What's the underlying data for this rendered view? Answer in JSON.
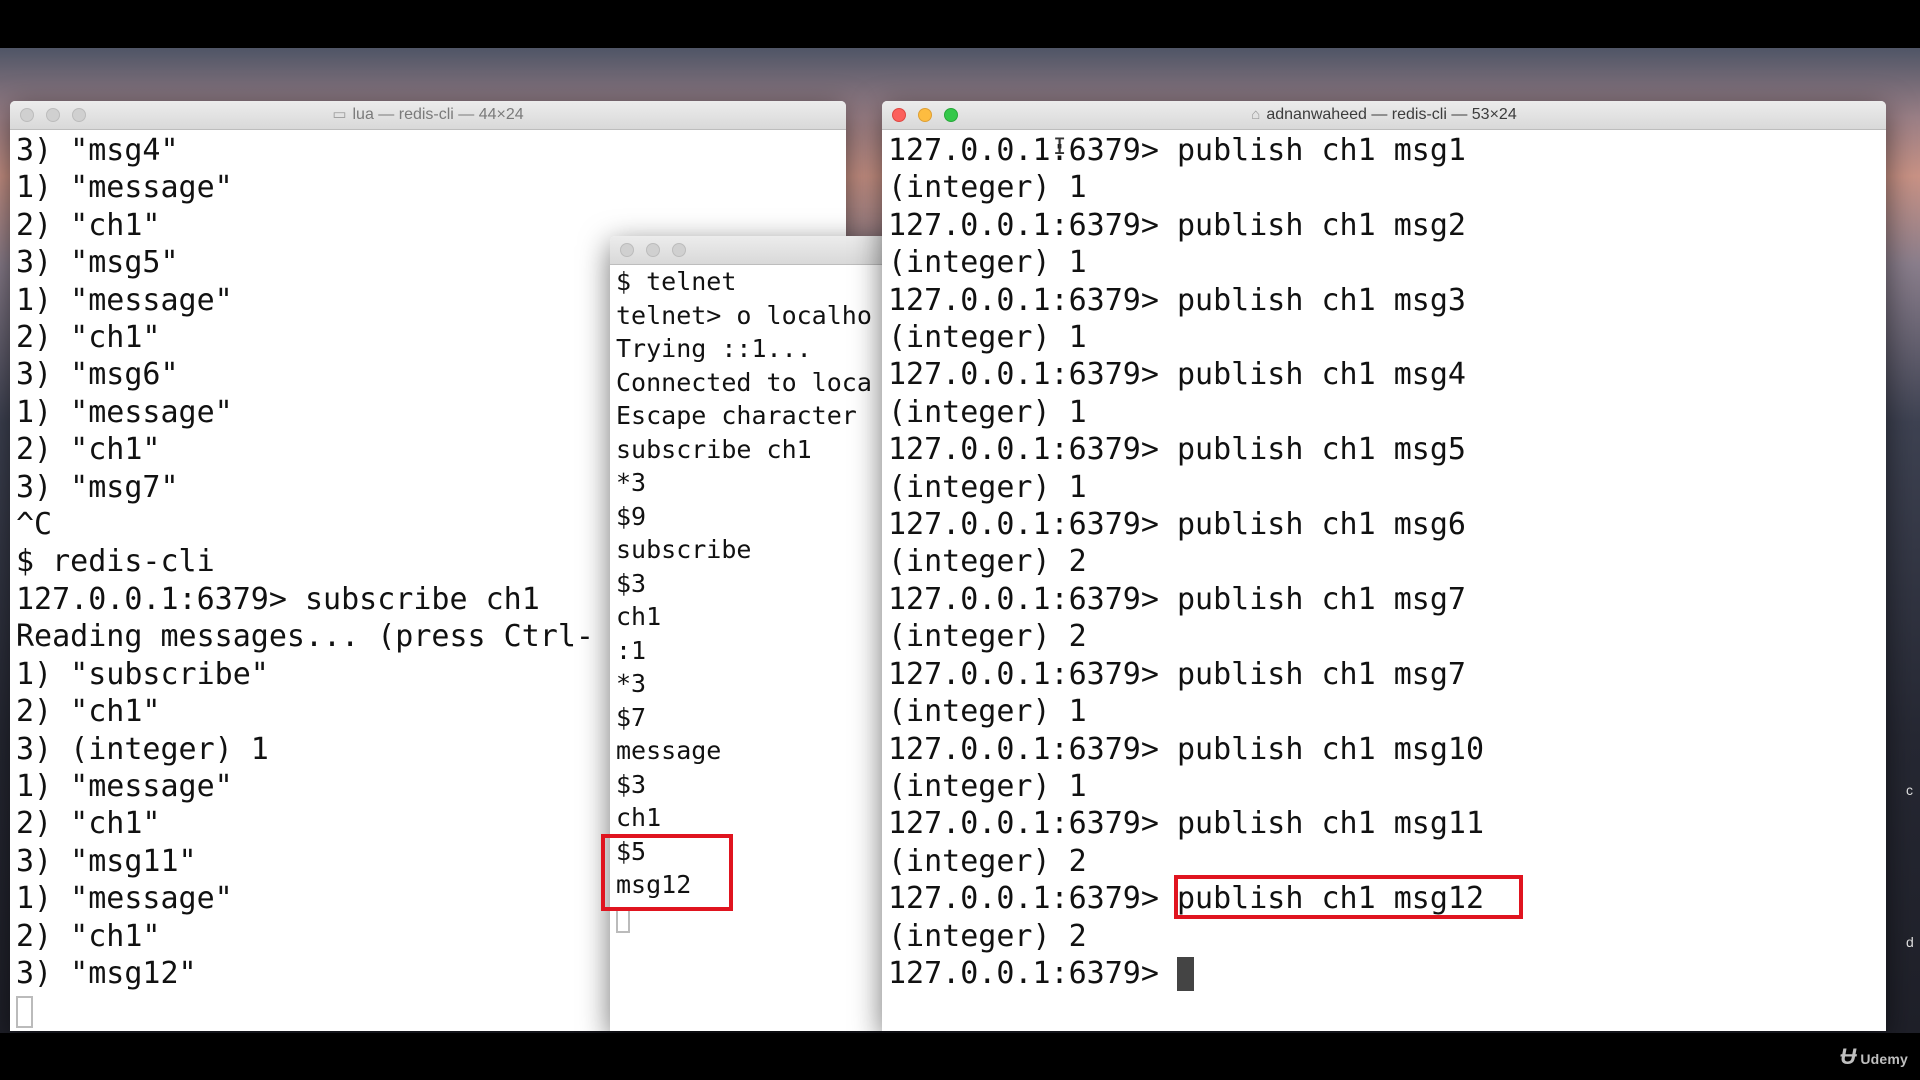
{
  "windows": {
    "left": {
      "title": "lua — redis-cli — 44×24",
      "title_icon": "folder-icon",
      "lines": [
        "3) \"msg4\"",
        "1) \"message\"",
        "2) \"ch1\"",
        "3) \"msg5\"",
        "1) \"message\"",
        "2) \"ch1\"",
        "3) \"msg6\"",
        "1) \"message\"",
        "2) \"ch1\"",
        "3) \"msg7\"",
        "^C",
        "$ redis-cli",
        "127.0.0.1:6379> subscribe ch1",
        "Reading messages... (press Ctrl-",
        "1) \"subscribe\"",
        "2) \"ch1\"",
        "3) (integer) 1",
        "1) \"message\"",
        "2) \"ch1\"",
        "3) \"msg11\"",
        "1) \"message\"",
        "2) \"ch1\"",
        "3) \"msg12\""
      ]
    },
    "middle": {
      "title": "",
      "lines": [
        "$ telnet",
        "telnet> o localho",
        "Trying ::1...",
        "Connected to loca",
        "Escape character",
        "subscribe ch1",
        "*3",
        "$9",
        "subscribe",
        "$3",
        "ch1",
        ":1",
        "*3",
        "$7",
        "message",
        "$3",
        "ch1",
        "$5",
        "msg12"
      ]
    },
    "right": {
      "title": "adnanwaheed — redis-cli — 53×24",
      "title_icon": "home-icon",
      "lines": [
        "127.0.0.1:6379> publish ch1 msg1",
        "(integer) 1",
        "127.0.0.1:6379> publish ch1 msg2",
        "(integer) 1",
        "127.0.0.1:6379> publish ch1 msg3",
        "(integer) 1",
        "127.0.0.1:6379> publish ch1 msg4",
        "(integer) 1",
        "127.0.0.1:6379> publish ch1 msg5",
        "(integer) 1",
        "127.0.0.1:6379> publish ch1 msg6",
        "(integer) 2",
        "127.0.0.1:6379> publish ch1 msg7",
        "(integer) 2",
        "127.0.0.1:6379> publish ch1 msg7",
        "(integer) 1",
        "127.0.0.1:6379> publish ch1 msg10",
        "(integer) 1",
        "127.0.0.1:6379> publish ch1 msg11",
        "(integer) 2",
        "127.0.0.1:6379> publish ch1 msg12",
        "(integer) 2",
        "127.0.0.1:6379> "
      ]
    }
  },
  "watermark": "Udemy",
  "colors": {
    "highlight": "#e0141f",
    "close": "#fc605c",
    "minimize": "#fdbc40",
    "zoom": "#34c84a"
  }
}
